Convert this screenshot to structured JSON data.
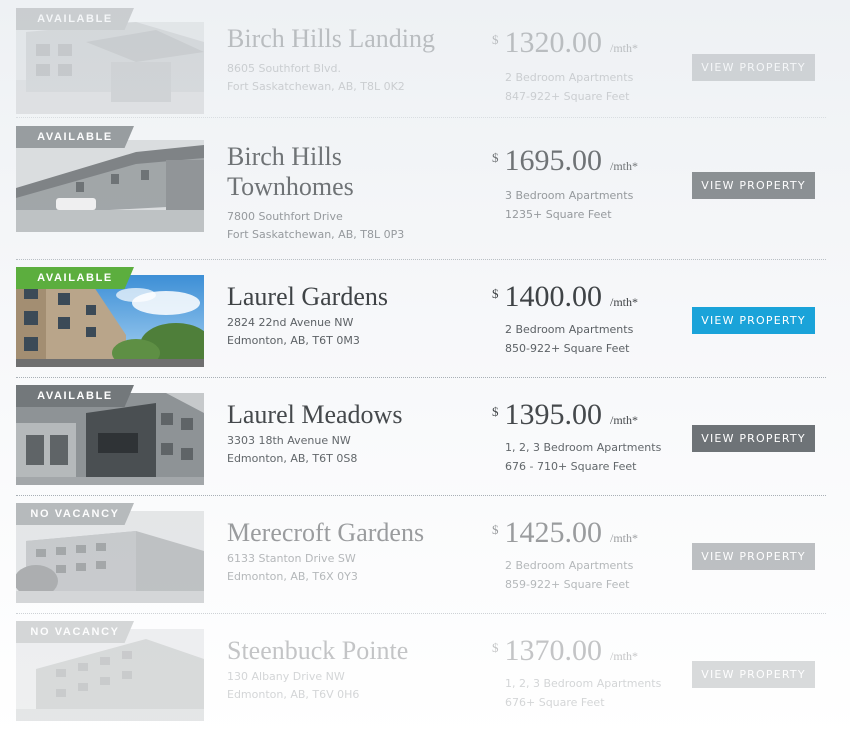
{
  "listings": [
    {
      "badge": "AVAILABLE",
      "name_line1": "Birch Hills Landing",
      "name_line2": "",
      "address_line1": "8605 Southfort Blvd.",
      "address_line2": "Fort Saskatchewan, AB, T8L 0K2",
      "currency": "$",
      "price": "1320.00",
      "per": "/mth*",
      "bedrooms": "2 Bedroom Apartments",
      "sqft": "847-922+ Square Feet",
      "button": "VIEW PROPERTY"
    },
    {
      "badge": "AVAILABLE",
      "name_line1": "Birch Hills",
      "name_line2": "Townhomes",
      "address_line1": "7800 Southfort Drive",
      "address_line2": "Fort Saskatchewan, AB, T8L 0P3",
      "currency": "$",
      "price": "1695.00",
      "per": "/mth*",
      "bedrooms": "3 Bedroom Apartments",
      "sqft": "1235+ Square Feet",
      "button": "VIEW PROPERTY"
    },
    {
      "badge": "AVAILABLE",
      "name_line1": "Laurel Gardens",
      "name_line2": "",
      "address_line1": "2824 22nd Avenue NW",
      "address_line2": "Edmonton, AB, T6T 0M3",
      "currency": "$",
      "price": "1400.00",
      "per": "/mth*",
      "bedrooms": "2 Bedroom Apartments",
      "sqft": "850-922+ Square Feet",
      "button": "VIEW PROPERTY"
    },
    {
      "badge": "AVAILABLE",
      "name_line1": "Laurel Meadows",
      "name_line2": "",
      "address_line1": "3303 18th Avenue NW",
      "address_line2": "Edmonton, AB, T6T 0S8",
      "currency": "$",
      "price": "1395.00",
      "per": "/mth*",
      "bedrooms": "1, 2, 3 Bedroom Apartments",
      "sqft": "676 - 710+ Square Feet",
      "button": "VIEW PROPERTY"
    },
    {
      "badge": "NO VACANCY",
      "name_line1": "Merecroft Gardens",
      "name_line2": "",
      "address_line1": "6133 Stanton Drive SW",
      "address_line2": "Edmonton, AB, T6X 0Y3",
      "currency": "$",
      "price": "1425.00",
      "per": "/mth*",
      "bedrooms": "2 Bedroom Apartments",
      "sqft": "859-922+ Square Feet",
      "button": "VIEW PROPERTY"
    },
    {
      "badge": "NO VACANCY",
      "name_line1": "Steenbuck Pointe",
      "name_line2": "",
      "address_line1": "130 Albany Drive NW",
      "address_line2": "Edmonton, AB, T6V 0H6",
      "currency": "$",
      "price": "1370.00",
      "per": "/mth*",
      "bedrooms": "1, 2, 3 Bedroom Apartments",
      "sqft": "676+ Square Feet",
      "button": "VIEW PROPERTY"
    }
  ],
  "colors": {
    "active_button": "#1aa3d9",
    "inactive_button": "#8a8f93",
    "available_green": "#5cae3e",
    "badge_gray": "#7f8588"
  }
}
